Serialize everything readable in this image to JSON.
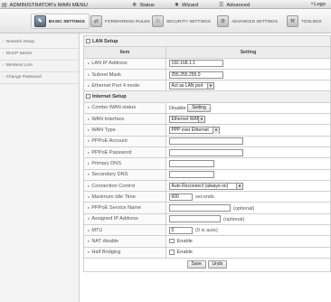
{
  "topbar": {
    "title": "ADMINISTRATOR's MAIN MENU",
    "status": "Status",
    "wizard": "Wizard",
    "advanced": "Advanced",
    "logout": "Logo"
  },
  "tabs": [
    {
      "label": "BASIC SETTINGS"
    },
    {
      "label": "FORWARDING RULES"
    },
    {
      "label": "SECURITY SETTINGS"
    },
    {
      "label": "ADVANCED SETTINGS"
    },
    {
      "label": "TOOLBOX"
    }
  ],
  "sidebar": {
    "items": [
      {
        "label": "Network Setup"
      },
      {
        "label": "DHCP Server"
      },
      {
        "label": "Wireless LAN"
      },
      {
        "label": "Change Password"
      }
    ]
  },
  "lan": {
    "section_title": "LAN Setup",
    "col_item": "Item",
    "col_setting": "Setting",
    "ip_label": "LAN IP Address",
    "ip_value": "192.168.1.1",
    "mask_label": "Subnet Mask",
    "mask_value": "255.255.255.0",
    "port4_label": "Ethernet Port 4 mode",
    "port4_value": "Act as LAN port"
  },
  "internet": {
    "section_title": "Internet Setup",
    "combo_label": "Combo WAN status",
    "combo_value": "Disable",
    "combo_button": "Setting",
    "wan_if_label": "WAN Interface",
    "wan_if_value": "Ethernet WAN",
    "wan_type_label": "WAN Type",
    "wan_type_value": "PPP over Ethernet",
    "account_label": "PPPoE Account",
    "account_value": "",
    "password_label": "PPPoE Password",
    "password_value": "",
    "dns1_label": "Primary DNS",
    "dns1_value": "",
    "dns2_label": "Secondary DNS",
    "dns2_value": "",
    "conn_label": "Connection Control",
    "conn_value": "Auto Reconnect (always-on)",
    "idle_label": "Maximum Idle Time",
    "idle_value": "600",
    "idle_unit": "seconds",
    "svc_label": "PPPoE Service Name",
    "svc_value": "",
    "svc_note": "(optional)",
    "aip_label": "Assigned IP Address",
    "aip_value": "",
    "aip_note": "(optional)",
    "mtu_label": "MTU",
    "mtu_value": "0",
    "mtu_note": "(0 is auto)",
    "nat_label": "NAT disable",
    "nat_option": "Enable",
    "half_label": "Half Bridging",
    "half_option": "Enable"
  },
  "actions": {
    "save": "Save",
    "undo": "Undo"
  }
}
